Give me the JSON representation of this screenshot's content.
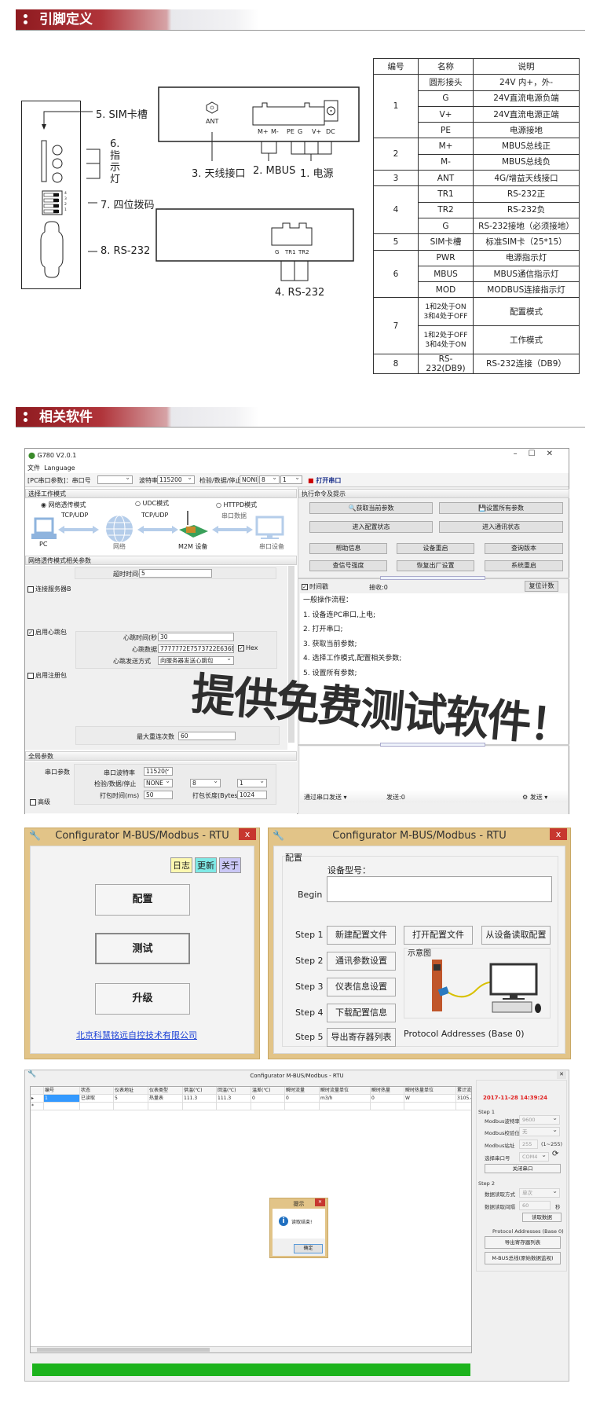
{
  "section1": {
    "title": "引脚定义"
  },
  "diagram": {
    "sim_label": "5. SIM卡槽",
    "led_label_num": "6.",
    "led_label_chars": [
      "指",
      "示",
      "灯"
    ],
    "dip_label": "7. 四位拨码",
    "dip_numbers": [
      "4",
      "3",
      "2",
      "1"
    ],
    "db9_label": "8. RS-232",
    "ant": "ANT",
    "top_pins": [
      "M+",
      "M-",
      "PE",
      "G",
      "V+",
      "DC"
    ],
    "antenna_label": "3. 天线接口",
    "mbus_label": "2. MBUS",
    "power_label": "1. 电源",
    "bottom_pins": [
      "G",
      "TR1",
      "TR2"
    ],
    "rs232_label": "4. RS-232"
  },
  "pin_table": {
    "headers": [
      "编号",
      "名称",
      "说明"
    ],
    "groups": [
      {
        "no": "1",
        "rows": [
          [
            "圆形接头",
            "24V  内+，外-"
          ],
          [
            "G",
            "24V直流电源负端"
          ],
          [
            "V+",
            "24V直流电源正端"
          ],
          [
            "PE",
            "电源接地"
          ]
        ]
      },
      {
        "no": "2",
        "rows": [
          [
            "M+",
            "MBUS总线正"
          ],
          [
            "M-",
            "MBUS总线负"
          ]
        ]
      },
      {
        "no": "3",
        "rows": [
          [
            "ANT",
            "4G/增益天线接口"
          ]
        ]
      },
      {
        "no": "4",
        "rows": [
          [
            "TR1",
            "RS-232正"
          ],
          [
            "TR2",
            "RS-232负"
          ],
          [
            "G",
            "RS-232接地（必须接地）"
          ]
        ]
      },
      {
        "no": "5",
        "rows": [
          [
            "SIM卡槽",
            "标准SIM卡（25*15）"
          ]
        ]
      },
      {
        "no": "6",
        "rows": [
          [
            "PWR",
            "电源指示灯"
          ],
          [
            "MBUS",
            "MBUS通信指示灯"
          ],
          [
            "MOD",
            "MODBUS连接指示灯"
          ]
        ]
      },
      {
        "no": "7",
        "double": true,
        "rows": [
          [
            "1和2处于ON\n3和4处于OFF",
            "配置模式"
          ],
          [
            "1和2处于OFF\n3和4处于ON",
            "工作模式"
          ]
        ]
      },
      {
        "no": "8",
        "rows": [
          [
            "RS-232(DB9)",
            "RS-232连接（DB9）"
          ]
        ]
      }
    ]
  },
  "section2": {
    "title": "相关软件"
  },
  "g780": {
    "title": "G780 V2.0.1",
    "menu": [
      "文件",
      "Language"
    ],
    "toolbar": {
      "port_label": "[PC串口参数]：串口号",
      "port_value": "",
      "baud_label": "波特率",
      "baud_value": "115200",
      "parity_label": "检验/数据/停止",
      "parity_value": "NONI",
      "data_bits": "8",
      "stop_bits": "1",
      "open_port": "打开串口"
    },
    "mode_section": "选择工作模式",
    "modes": [
      {
        "label": "网络透传模式",
        "selected": true
      },
      {
        "label": "UDC模式",
        "selected": false
      },
      {
        "label": "HTTPD模式",
        "selected": false
      }
    ],
    "flow": {
      "pc": "PC",
      "tcp1": "TCP/UDP",
      "network": "网络",
      "tcp2": "TCP/UDP",
      "device": "M2M 设备",
      "serial_data": "串口数据",
      "serial_device": "串口设备"
    },
    "params_section": "网络透传模式相关参数",
    "timeout_label": "超时时间(秒)",
    "timeout_value": "5",
    "server_b": "连接服务器B",
    "heartbeat_enable": "启用心跳包",
    "hb_time_label": "心跳时间(秒",
    "hb_time_value": "30",
    "hb_data_label": "心跳数据",
    "hb_data_value": "7777772E7573722E636E",
    "hex_label": "Hex",
    "hb_mode_label": "心跳发送方式",
    "hb_mode_value": "向服务器发送心跳包",
    "register_enable": "启用注册包",
    "max_reconnect_label": "最大重连次数",
    "max_reconnect_value": "60",
    "global_section": "全局参数",
    "serial_params": "串口参数",
    "g_baud_label": "串口波特率",
    "g_baud_value": "11520(",
    "g_parity_label": "检验/数据/停止",
    "g_parity_value": "NONE",
    "g_data_value": "8",
    "g_stop_value": "1",
    "pack_time_label": "打包时间(ms)",
    "pack_time_value": "50",
    "pack_len_label": "打包长度(Bytes)",
    "pack_len_value": "1024",
    "advanced": "高级",
    "cmd_section": "执行命令及提示",
    "buttons_wide": [
      "获取当前参数",
      "设置所有参数",
      "进入配置状态",
      "进入通讯状态"
    ],
    "buttons_small": [
      "帮助信息",
      "设备重启",
      "查询版本",
      "查信号强度",
      "恢复出厂设置",
      "系统重启"
    ],
    "timestamp": "时间戳",
    "receive": "接收:0",
    "reset_count": "复位计数",
    "log_lines": [
      "一般操作流程：",
      "1. 设备连PC串口,上电;",
      "2. 打开串口;",
      "3. 获取当前参数;",
      "4. 选择工作模式,配置相关参数;",
      "5. 设置所有参数;"
    ],
    "send_via": "通过串口发送",
    "send_count": "发送:0",
    "send_button": "发送"
  },
  "overlay_text": "提供免费测试软件！",
  "cfg_main": {
    "title": "Configurator M-BUS/Modbus - RTU",
    "close": "x",
    "top_buttons": [
      {
        "label": "日志",
        "color": "#fdf8b0"
      },
      {
        "label": "更新",
        "color": "#7fe9e6"
      },
      {
        "label": "关于",
        "color": "#c9c6f5"
      }
    ],
    "big_buttons": [
      "配置",
      "测试",
      "升级"
    ],
    "company_link": "北京科慧铭远自控技术有限公司"
  },
  "cfg_config": {
    "title": "Configurator M-BUS/Modbus - RTU",
    "close": "x",
    "group": "配置",
    "model_label": "设备型号：",
    "begin": "Begin",
    "begin_value": "",
    "steps": [
      "Step 1",
      "Step 2",
      "Step 3",
      "Step 4",
      "Step 5"
    ],
    "step_buttons": [
      "新建配置文件",
      "通讯参数设置",
      "仪表信息设置",
      "下载配置信息",
      "导出寄存器列表"
    ],
    "open_file": "打开配置文件",
    "read_device": "从设备读取配置",
    "schematic": "示意图",
    "protocol": "Protocol Addresses (Base 0)"
  },
  "cfg_read": {
    "title": "Configurator M-BUS/Modbus - RTU",
    "columns": [
      "编号",
      "状态",
      "仪表地址",
      "仪表类型",
      "供温(℃)",
      "回温(℃)",
      "温差(℃)",
      "瞬时流量",
      "瞬时流量单位",
      "瞬时热量",
      "瞬时热量单位",
      "累计流量"
    ],
    "rows": [
      [
        "1",
        "已读取",
        "5",
        "热量表",
        "111.3",
        "111.3",
        "0",
        "0",
        "m3/h",
        "0",
        "W",
        "3105.495"
      ]
    ],
    "datetime": "2017-11-28 14:39:24",
    "step1": "Step 1",
    "baud_label": "Modbus波特率",
    "baud_value": "9600",
    "parity_label": "Modbus校验位",
    "parity_value": "无",
    "addr_label": "Modbus站址",
    "addr_value": "255",
    "addr_range": "(1~255)",
    "port_label": "选择串口号",
    "port_value": "COM4",
    "close_port": "关闭串口",
    "step2": "Step 2",
    "read_mode_label": "数据读取方式",
    "read_mode_value": "单次",
    "interval_label": "数据读取间隔",
    "interval_value": "60",
    "interval_unit": "秒",
    "read_data": "读取数据",
    "protocol": "Protocol Addresses (Base 0)",
    "export": "导出寄存器列表",
    "monitor": "M-BUS总线(原始数据监视)",
    "progress": 100,
    "progress_color": "#1db31d",
    "dialog": {
      "title": "提示",
      "message": "读取结束!",
      "ok": "确定"
    }
  },
  "colors": {
    "accent_red": "#9b1c22",
    "datetime_red": "#e02020",
    "link_blue": "#1a3fd6",
    "window_frame": "#e2c488"
  }
}
